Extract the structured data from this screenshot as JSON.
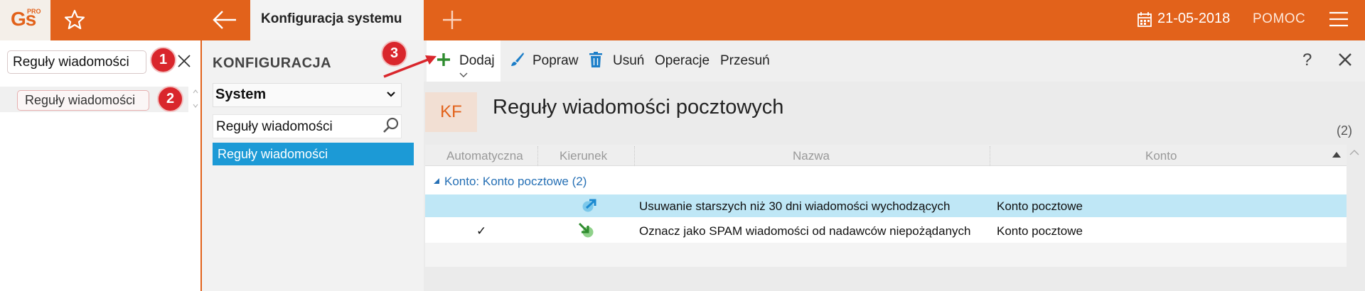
{
  "app": {
    "logo": "Gs",
    "logo_badge": "PRO",
    "active_tab": "Konfiguracja systemu",
    "date": "21-05-2018",
    "help": "POMOC"
  },
  "left_search": {
    "query": "Reguły wiadomości",
    "result": "Reguły wiadomości"
  },
  "config": {
    "title": "KONFIGURACJA",
    "select_value": "System",
    "search_value": "Reguły wiadomości",
    "selected_item": "Reguły wiadomości"
  },
  "toolbar": {
    "add": "Dodaj",
    "edit": "Popraw",
    "delete": "Usuń",
    "operations": "Operacje",
    "move": "Przesuń",
    "help": "?"
  },
  "page": {
    "badge": "KF",
    "title": "Reguły wiadomości pocztowych",
    "count": "(2)"
  },
  "table": {
    "columns": [
      "Automatyczna",
      "Kierunek",
      "Nazwa",
      "Konto"
    ],
    "group_label": "Konto:",
    "group_value": "Konto pocztowe (2)",
    "rows": [
      {
        "automatic": "",
        "direction": "outgoing-icon",
        "name": "Usuwanie starszych niż 30 dni wiadomości wychodzących",
        "account": "Konto pocztowe"
      },
      {
        "automatic": "✓",
        "direction": "incoming-icon",
        "name": "Oznacz jako SPAM wiadomości od nadawców niepożądanych",
        "account": "Konto pocztowe"
      }
    ]
  },
  "annotations": [
    "1",
    "2",
    "3"
  ],
  "colors": {
    "brand": "#e2621b",
    "selection": "#1c9ad6",
    "row_highlight": "#bfe7f6",
    "badge": "#d9262c"
  }
}
